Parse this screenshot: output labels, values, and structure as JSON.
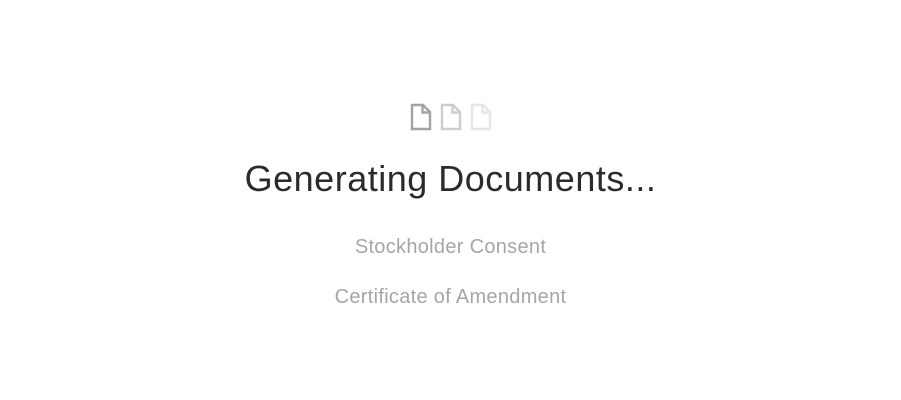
{
  "title": "Generating Documents...",
  "icons": [
    {
      "name": "document-icon",
      "color": "#a3a3a3"
    },
    {
      "name": "document-icon",
      "color": "#cdcdcd"
    },
    {
      "name": "document-icon",
      "color": "#e6e6e6"
    }
  ],
  "documents": [
    {
      "label": "Stockholder Consent"
    },
    {
      "label": "Certificate of Amendment"
    }
  ]
}
